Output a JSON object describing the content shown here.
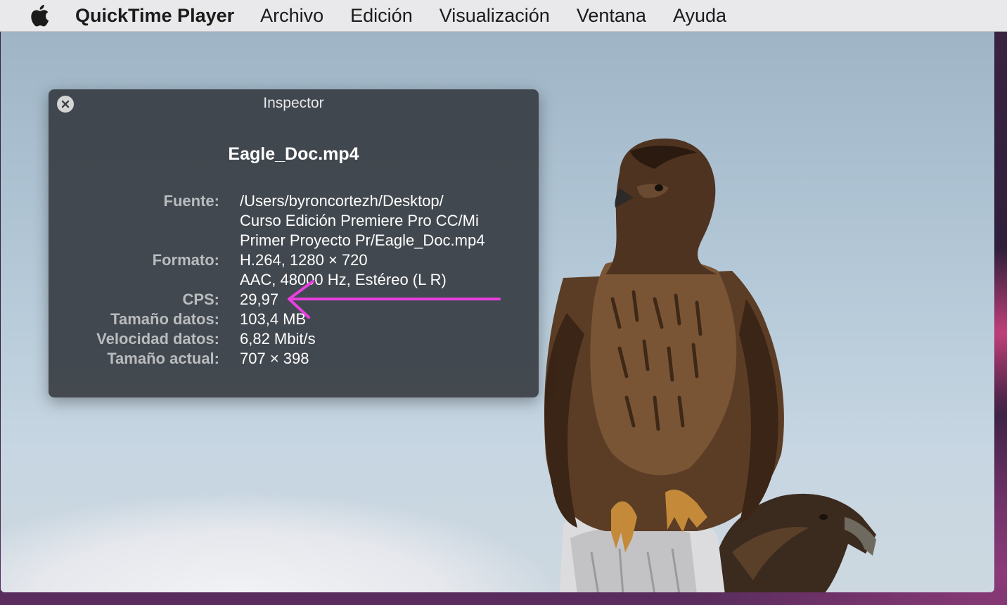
{
  "menubar": {
    "apple_icon": "apple-icon",
    "app_name": "QuickTime Player",
    "items": [
      "Archivo",
      "Edición",
      "Visualización",
      "Ventana",
      "Ayuda"
    ]
  },
  "inspector": {
    "title": "Inspector",
    "filename": "Eagle_Doc.mp4",
    "fields": {
      "source_label": "Fuente:",
      "source_lines": [
        "/Users/byroncortezh/Desktop/",
        "Curso Edición Premiere Pro CC/Mi",
        "Primer Proyecto Pr/Eagle_Doc.mp4"
      ],
      "format_label": "Formato:",
      "format_lines": [
        "H.264, 1280 × 720",
        "AAC, 48000 Hz, Estéreo (L R)"
      ],
      "fps_label": "CPS:",
      "fps_value": "29,97",
      "data_size_label": "Tamaño datos:",
      "data_size_value": "103,4 MB",
      "data_rate_label": "Velocidad datos:",
      "data_rate_value": "6,82 Mbit/s",
      "current_size_label": "Tamaño actual:",
      "current_size_value": "707 × 398"
    }
  },
  "annotation": {
    "arrow_color": "#e83fe0"
  },
  "colors": {
    "menubar_bg": "#e9e8ea",
    "inspector_bg": "#3a4046",
    "label_gray": "#b9bcbf"
  }
}
